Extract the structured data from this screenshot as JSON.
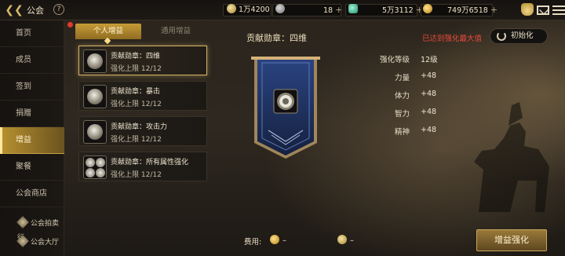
{
  "header": {
    "back_icon": "back-arrow-icon",
    "title": "公会",
    "help_label": "?",
    "resources": [
      {
        "icon": "pill-icon",
        "value": "1万4200"
      },
      {
        "icon": "coin-icon",
        "value": "18"
      },
      {
        "icon": "gem-icon",
        "value": "5万3112"
      },
      {
        "icon": "gold-icon",
        "value": "749万6518"
      }
    ],
    "plus_label": "+",
    "right_icons": [
      "bag-icon",
      "mail-icon",
      "menu-icon"
    ]
  },
  "sidebar": {
    "items": [
      {
        "label": "首页"
      },
      {
        "label": "成员"
      },
      {
        "label": "签到"
      },
      {
        "label": "捐赠"
      },
      {
        "label": "增益",
        "active": true
      },
      {
        "label": "聚餐"
      },
      {
        "label": "公会商店"
      }
    ],
    "sub_items": [
      {
        "label": "公会拍卖行"
      },
      {
        "label": "公会大厅"
      }
    ]
  },
  "tabs": [
    {
      "label": "个人增益",
      "active": true
    },
    {
      "label": "通用增益",
      "active": false
    }
  ],
  "buff_list": [
    {
      "name": "贡献勋章：四维",
      "sub": "强化上限 12/12",
      "active": true
    },
    {
      "name": "贡献勋章：暴击",
      "sub": "强化上限 12/12",
      "active": false
    },
    {
      "name": "贡献勋章：攻击力",
      "sub": "强化上限 12/12",
      "active": false
    },
    {
      "name": "贡献勋章：所有属性强化",
      "sub": "强化上限 12/12",
      "active": false
    }
  ],
  "detail": {
    "title": "贡献勋章：四维",
    "maxed_text": "已达到强化最大值",
    "reset_label": "初始化",
    "stats": [
      {
        "key": "强化等级",
        "value": "12级"
      },
      {
        "key": "力量",
        "value": "+48"
      },
      {
        "key": "体力",
        "value": "+48"
      },
      {
        "key": "智力",
        "value": "+48"
      },
      {
        "key": "精神",
        "value": "+48"
      }
    ]
  },
  "footer": {
    "cost_label": "费用:",
    "cost_gold": "–",
    "cost_pill": "–",
    "enhance_label": "增益强化"
  },
  "colors": {
    "accent_gold": "#c69b37",
    "warning_red": "#e5483a",
    "banner_blue": "#1f3466"
  }
}
